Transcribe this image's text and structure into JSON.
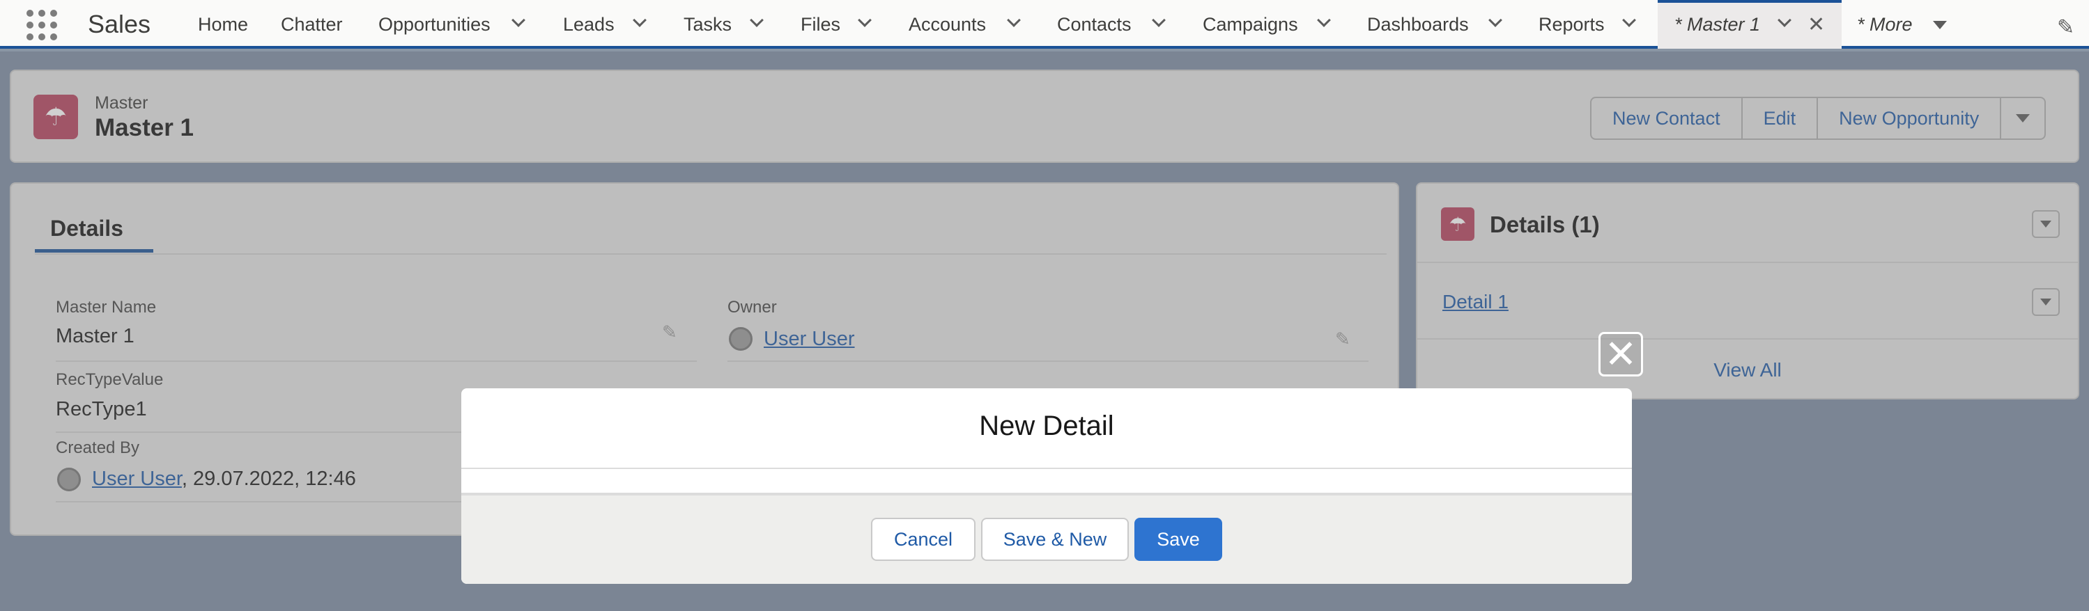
{
  "app": {
    "name": "Sales"
  },
  "nav": {
    "items": [
      {
        "label": "Home"
      },
      {
        "label": "Chatter"
      },
      {
        "label": "Opportunities"
      },
      {
        "label": "Leads"
      },
      {
        "label": "Tasks"
      },
      {
        "label": "Files"
      },
      {
        "label": "Accounts"
      },
      {
        "label": "Contacts"
      },
      {
        "label": "Campaigns"
      },
      {
        "label": "Dashboards"
      },
      {
        "label": "Reports"
      }
    ],
    "active_tab": "* Master 1",
    "more": "* More"
  },
  "record": {
    "object_label": "Master",
    "title": "Master 1",
    "actions": {
      "new_contact": "New Contact",
      "edit": "Edit",
      "new_opportunity": "New Opportunity"
    }
  },
  "details_panel": {
    "tab": "Details",
    "fields": {
      "master_name_label": "Master Name",
      "master_name_value": "Master 1",
      "owner_label": "Owner",
      "owner_value": "User User",
      "rectype_label": "RecTypeValue",
      "rectype_value": "RecType1",
      "created_by_label": "Created By",
      "created_by_user": "User User",
      "created_by_date": ", 29.07.2022, 12:46"
    }
  },
  "related": {
    "title": "Details (1)",
    "item": "Detail 1",
    "view_all": "View All"
  },
  "modal": {
    "title": "New Detail",
    "cancel": "Cancel",
    "save_new": "Save & New",
    "save": "Save"
  },
  "colors": {
    "brand": "#1b5297",
    "accent_button": "#2e74d0",
    "record_icon": "#b5425e"
  }
}
